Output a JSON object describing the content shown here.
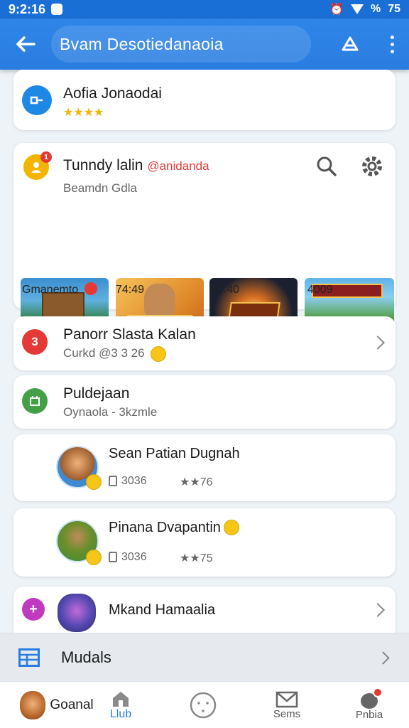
{
  "status_bar": {
    "time": "9:2:16",
    "battery": "75",
    "signal": "%"
  },
  "app_bar": {
    "title": "Bvam Desotiedanaoia",
    "back_icon": "arrow-left-icon",
    "action_icon": "triangle-a-icon",
    "menu_icon": "more-vert-icon"
  },
  "cards": {
    "first": {
      "title": "Aofia Jonaodai",
      "stars": "★★★★",
      "icon_color": "#1e88e5"
    },
    "games": {
      "title": "Tunndy lalin",
      "handle": "@anidanda",
      "subtitle": "Beamdn Gdla",
      "badge": "1",
      "search_icon": "search-icon",
      "settings_icon": "gear-icon",
      "thumbs": [
        {
          "label": "Gmanemto"
        },
        {
          "label": "74:49"
        },
        {
          "label": "20:40"
        },
        {
          "label": "4009"
        }
      ]
    },
    "panorr": {
      "title": "Panorr Slasta Kalan",
      "subtitle": "Curkd @3 3 26",
      "icon_text": "3",
      "icon_color": "#e53935"
    },
    "puldejaan": {
      "title": "Puldejaan",
      "subtitle": "Oynaola - 3kzmle",
      "icon_color": "#43a047"
    },
    "sean": {
      "title": "Sean Patian Dugnah",
      "count": "3036",
      "rating": "★★76"
    },
    "pinana": {
      "title": "Pinana Dvapantin",
      "count": "3036",
      "rating": "★★75"
    },
    "mkand": {
      "title": "Mkand Hamaalia",
      "icon_text": "+",
      "icon_color": "#c03ac0"
    }
  },
  "modules": {
    "label": "Mudals",
    "icon": "table-icon"
  },
  "bottom_nav": [
    {
      "label": "Goanal",
      "icon": "avatar-icon"
    },
    {
      "label": "Llub",
      "icon": "home-icon",
      "active": true
    },
    {
      "label": "",
      "icon": "face-icon"
    },
    {
      "label": "Sems",
      "icon": "mail-icon"
    },
    {
      "label": "Pnbia",
      "icon": "profile-icon"
    }
  ]
}
